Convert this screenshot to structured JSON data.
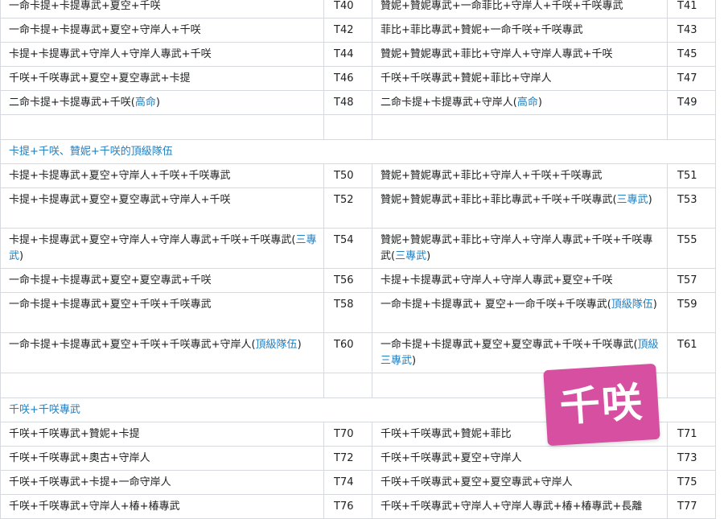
{
  "rows_top": [
    {
      "l": "一命卡提+卡提專武+夏空+千咲",
      "lc": "T40",
      "r": "贊妮+贊妮專武+一命菲比+守岸人+千咲+千咲專武",
      "rc": "T41"
    },
    {
      "l": "一命卡提+卡提專武+夏空+守岸人+千咲",
      "lc": "T42",
      "r": "菲比+菲比專武+贊妮+一命千咲+千咲專武",
      "rc": "T43"
    },
    {
      "l": "卡提+卡提專武+守岸人+守岸人專武+千咲",
      "lc": "T44",
      "r": "贊妮+贊妮專武+菲比+守岸人+守岸人專武+千咲",
      "rc": "T45"
    },
    {
      "l": "千咲+千咲專武+夏空+夏空專武+卡提",
      "lc": "T46",
      "r": "千咲+千咲專武+贊妮+菲比+守岸人",
      "rc": "T47"
    },
    {
      "l": "二命卡提+卡提專武+千咲(",
      "ln": "高命",
      "lt": ")",
      "lc": "T48",
      "r": "二命卡提+卡提專武+守岸人(",
      "rn": "高命",
      "rt": ")",
      "rc": "T49"
    }
  ],
  "section1": "卡提+千咲、贊妮+千咲的頂級隊伍",
  "rows_mid": [
    {
      "l": "卡提+卡提專武+夏空+守岸人+千咲+千咲專武",
      "lc": "T50",
      "r": "贊妮+贊妮專武+菲比+守岸人+千咲+千咲專武",
      "rc": "T51"
    },
    {
      "l": "卡提+卡提專武+夏空+夏空專武+守岸人+千咲",
      "lc": "T52",
      "r": "贊妮+贊妮專武+菲比+菲比專武+千咲+千咲專武(",
      "rn": "三專武",
      "rt": ")",
      "rc": "T53"
    },
    {
      "l": "卡提+卡提專武+夏空+守岸人+守岸人專武+千咲+千咲專武(",
      "ln": "三專武",
      "lt": ")",
      "lc": "T54",
      "r": "贊妮+贊妮專武+菲比+守岸人+守岸人專武+千咲+千咲專武(",
      "rn": "三專武",
      "rt": ")",
      "rc": "T55"
    },
    {
      "l": "一命卡提+卡提專武+夏空+夏空專武+千咲",
      "lc": "T56",
      "r": "卡提+卡提專武+守岸人+守岸人專武+夏空+千咲",
      "rc": "T57"
    },
    {
      "l": "一命卡提+卡提專武+夏空+千咲+千咲專武",
      "lc": "T58",
      "r": "一命卡提+卡提專武+ 夏空+一命千咲+千咲專武(",
      "rn": "頂級隊伍",
      "rt": ")",
      "rc": "T59"
    },
    {
      "l": "一命卡提+卡提專武+夏空+千咲+千咲專武+守岸人(",
      "ln": "頂級隊伍",
      "lt": ")",
      "lc": "T60",
      "r": "一命卡提+卡提專武+夏空+夏空專武+千咲+千咲專武(",
      "rn": "頂級三專武",
      "rt": ")",
      "rc": "T61"
    }
  ],
  "section2": "千咲+千咲專武",
  "rows_bottom": [
    {
      "l": "千咲+千咲專武+贊妮+卡提",
      "lc": "T70",
      "r": "千咲+千咲專武+贊妮+菲比",
      "rc": "T71"
    },
    {
      "l": "千咲+千咲專武+奧古+守岸人",
      "lc": "T72",
      "r": "千咲+千咲專武+夏空+守岸人",
      "rc": "T73"
    },
    {
      "l": "千咲+千咲專武+卡提+一命守岸人",
      "lc": "T74",
      "r": "千咲+千咲專武+夏空+夏空專武+守岸人",
      "rc": "T75"
    },
    {
      "l": "千咲+千咲專武+守岸人+椿+椿專武",
      "lc": "T76",
      "r": "千咲+千咲專武+守岸人+守岸人專武+椿+椿專武+長離",
      "rc": "T77"
    }
  ],
  "stamp": "千咲",
  "colors": {
    "link": "#1f7fc0",
    "border": "#d6d9dd",
    "stamp_bg": "#d64fa1"
  }
}
